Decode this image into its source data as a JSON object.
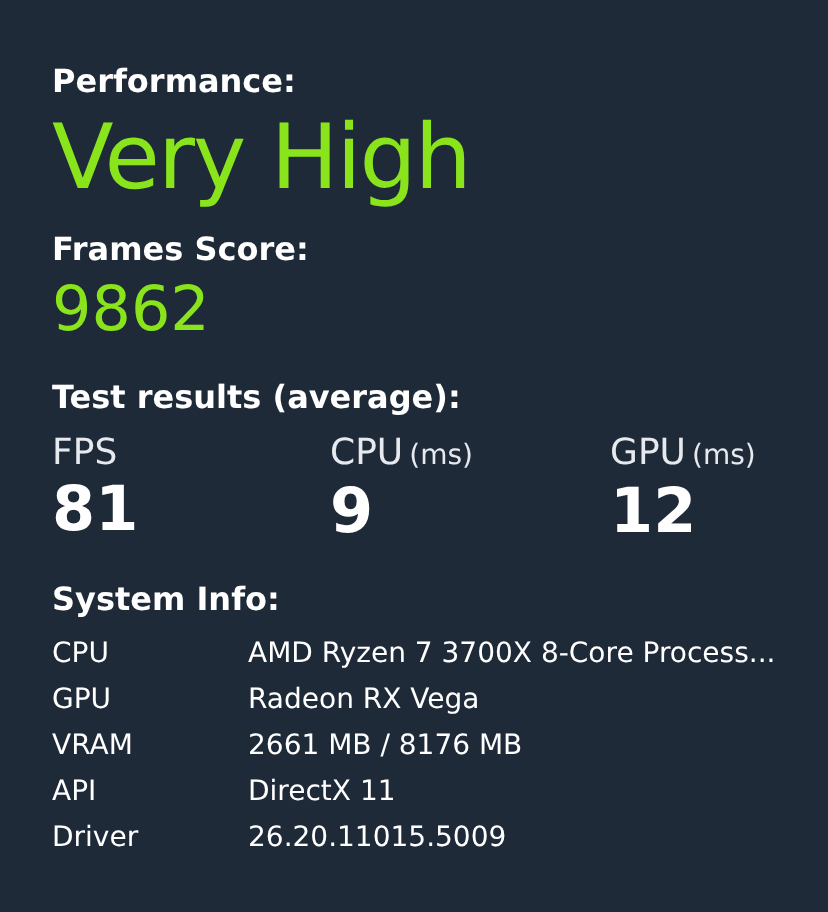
{
  "performance": {
    "label": "Performance:",
    "value": "Very High"
  },
  "frames_score": {
    "label": "Frames Score:",
    "value": "9862"
  },
  "test_results": {
    "label": "Test results (average):",
    "metrics": [
      {
        "label": "FPS",
        "value": "81"
      },
      {
        "label": "CPU",
        "unit": "(ms)",
        "value": "9"
      },
      {
        "label": "GPU",
        "unit": "(ms)",
        "value": "12"
      }
    ]
  },
  "system_info": {
    "label": "System Info:",
    "rows": [
      {
        "key": "CPU",
        "value": "AMD Ryzen 7 3700X 8-Core Process..."
      },
      {
        "key": "GPU",
        "value": "Radeon RX Vega"
      },
      {
        "key": "VRAM",
        "value": "2661 MB / 8176 MB"
      },
      {
        "key": "API",
        "value": "DirectX 11"
      },
      {
        "key": "Driver",
        "value": "26.20.11015.5009"
      }
    ]
  }
}
